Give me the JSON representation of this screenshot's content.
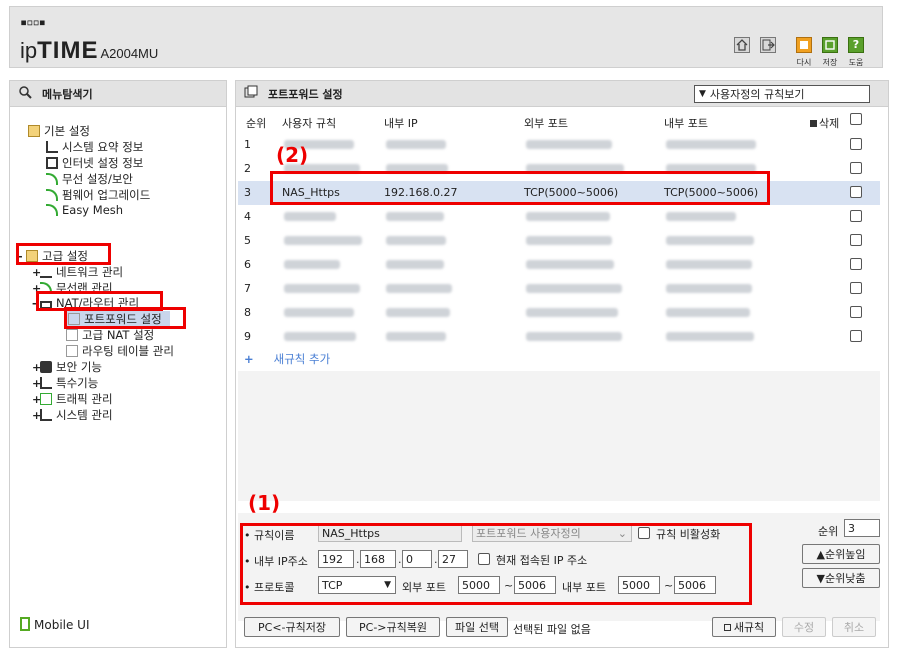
{
  "header": {
    "dots": "▪▫▫▪",
    "logo_ip": "ip",
    "logo_time": "TIME",
    "model": "A2004MU",
    "buttons": [
      {
        "label": "다시",
        "icon": "refresh-icon"
      },
      {
        "label": "저장",
        "icon": "save-icon"
      },
      {
        "label": "도움",
        "icon": "help-icon"
      }
    ]
  },
  "sidebar": {
    "title": "메뉴탐색기",
    "basic": {
      "label": "기본 설정",
      "items": [
        "시스템 요약 정보",
        "인터넷 설정 정보",
        "무선 설정/보안",
        "펌웨어 업그레이드",
        "Easy Mesh"
      ]
    },
    "advanced": {
      "label": "고급 설정",
      "items": [
        "네트워크 관리",
        "무선랜 관리",
        "NAT/라우터 관리"
      ],
      "nat_items": [
        "포트포워드 설정",
        "고급 NAT 설정",
        "라우팅 테이블 관리"
      ],
      "more": [
        "보안 기능",
        "특수기능",
        "트래픽 관리",
        "시스템 관리"
      ]
    },
    "mobile_ui": "Mobile UI"
  },
  "main": {
    "title": "포트포워드 설정",
    "view_select": "사용자정의 규칙보기",
    "columns": {
      "num": "순위",
      "rule": "사용자 규칙",
      "ip": "내부 IP",
      "ext": "외부 포트",
      "int": "내부 포트",
      "del": "삭제"
    },
    "rows": [
      {
        "num": "1",
        "rule": "",
        "ip": "",
        "ext": "",
        "int": ""
      },
      {
        "num": "2",
        "rule": "",
        "ip": "",
        "ext": "",
        "int": ""
      },
      {
        "num": "3",
        "rule": "NAS_Https",
        "ip": "192.168.0.27",
        "ext": "TCP(5000~5006)",
        "int": "TCP(5000~5006)"
      },
      {
        "num": "4",
        "rule": "",
        "ip": "",
        "ext": "",
        "int": ""
      },
      {
        "num": "5",
        "rule": "",
        "ip": "",
        "ext": "",
        "int": ""
      },
      {
        "num": "6",
        "rule": "",
        "ip": "",
        "ext": "",
        "int": ""
      },
      {
        "num": "7",
        "rule": "",
        "ip": "",
        "ext": "",
        "int": ""
      },
      {
        "num": "8",
        "rule": "",
        "ip": "",
        "ext": "",
        "int": ""
      },
      {
        "num": "9",
        "rule": "",
        "ip": "",
        "ext": "",
        "int": ""
      }
    ],
    "add_rule": "새규칙 추가"
  },
  "form": {
    "rule_name_label": "규칙이름",
    "rule_name_value": "NAS_Https",
    "type_select": "포트포워드 사용자정의",
    "disable_label": "규칙 비활성화",
    "ip_label": "내부 IP주소",
    "ip_octets": [
      "192",
      "168",
      "0",
      "27"
    ],
    "current_ip_label": "현재 접속된 IP 주소",
    "protocol_label": "프로토콜",
    "protocol_value": "TCP",
    "ext_port_label": "외부 포트",
    "ext_port_from": "5000",
    "ext_port_to": "5006",
    "int_port_label": "내부 포트",
    "int_port_from": "5000",
    "int_port_to": "5006",
    "tilde": "~",
    "rank_label": "순위",
    "rank_value": "3",
    "rank_up": "▲순위높임",
    "rank_down": "▼순위낮춤"
  },
  "footer": {
    "pc_save": "PC<-규칙저장",
    "pc_restore": "PC->규칙복원",
    "file_select": "파일 선택",
    "no_file": "선택된 파일 없음",
    "new_rule": "새규칙",
    "modify": "수정",
    "cancel": "취소"
  },
  "annotations": {
    "one": "(1)",
    "two": "(2)"
  },
  "colors": {
    "highlight": "#e00000",
    "selected_row": "#d8e2f2",
    "accent_orange": "#f0a020",
    "accent_green": "#5aa02c"
  }
}
